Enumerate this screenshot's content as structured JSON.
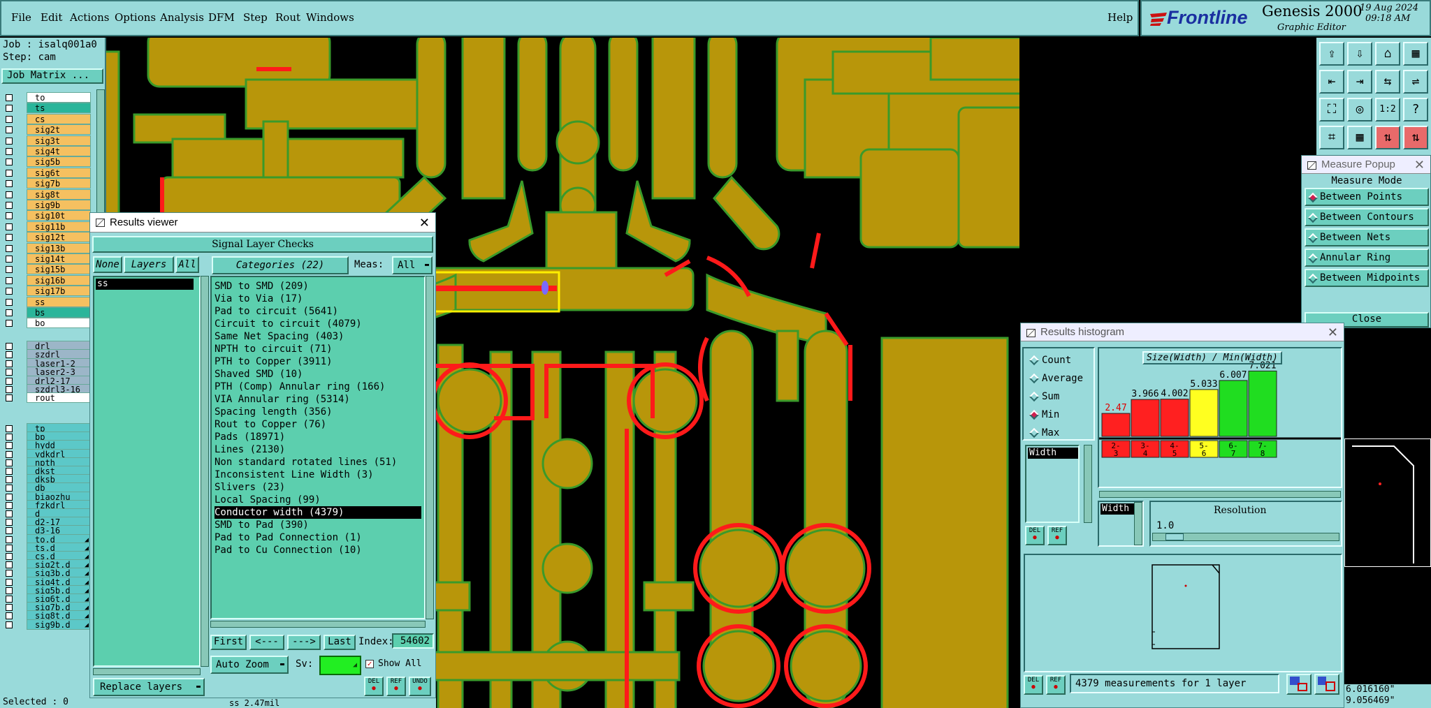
{
  "menu": [
    "File",
    "Edit",
    "Actions",
    "Options",
    "Analysis",
    "DFM",
    "Step",
    "Rout",
    "Windows"
  ],
  "help": "Help",
  "brand": {
    "logo": "Frontline",
    "product": "Genesis 2000",
    "subtitle": "Graphic Editor",
    "date": "19 Aug 2024",
    "time": "09:18 AM"
  },
  "job": {
    "job_label": "Job : isalq001a0",
    "step_label": "Step: cam",
    "matrix_button": "Job Matrix ..."
  },
  "layers_group1": [
    {
      "name": "to",
      "color": "#ffffff"
    },
    {
      "name": "ts",
      "color": "#2ab59a"
    },
    {
      "name": "cs",
      "color": "#f5c060"
    },
    {
      "name": "sig2t",
      "color": "#f5c060"
    },
    {
      "name": "sig3t",
      "color": "#f5c060"
    },
    {
      "name": "sig4t",
      "color": "#f5c060"
    },
    {
      "name": "sig5b",
      "color": "#f5c060"
    },
    {
      "name": "sig6t",
      "color": "#f5c060"
    },
    {
      "name": "sig7b",
      "color": "#f5c060"
    },
    {
      "name": "sig8t",
      "color": "#f5c060"
    },
    {
      "name": "sig9b",
      "color": "#f5c060"
    },
    {
      "name": "sig10t",
      "color": "#f5c060"
    },
    {
      "name": "sig11b",
      "color": "#f5c060"
    },
    {
      "name": "sig12t",
      "color": "#f5c060"
    },
    {
      "name": "sig13b",
      "color": "#f5c060"
    },
    {
      "name": "sig14t",
      "color": "#f5c060"
    },
    {
      "name": "sig15b",
      "color": "#f5c060"
    },
    {
      "name": "sig16b",
      "color": "#f5c060"
    },
    {
      "name": "sig17b",
      "color": "#f5c060"
    },
    {
      "name": "ss",
      "color": "#f5c060"
    },
    {
      "name": "bs",
      "color": "#2ab59a"
    },
    {
      "name": "bo",
      "color": "#ffffff"
    }
  ],
  "layers_group2": [
    {
      "name": "drl",
      "color": "#9cb6c8"
    },
    {
      "name": "szdrl",
      "color": "#9cb6c8"
    },
    {
      "name": "laser1-2",
      "color": "#9cb6c8"
    },
    {
      "name": "laser2-3",
      "color": "#9cb6c8"
    },
    {
      "name": "drl2-17",
      "color": "#9cb6c8"
    },
    {
      "name": "szdrl3-16",
      "color": "#9cb6c8"
    },
    {
      "name": "rout",
      "color": "#ffffff"
    }
  ],
  "layers_group3": [
    {
      "name": "tp",
      "a": ""
    },
    {
      "name": "bp",
      "a": ""
    },
    {
      "name": "hydd",
      "a": ""
    },
    {
      "name": "ydkdrl",
      "a": ""
    },
    {
      "name": "npth",
      "a": ""
    },
    {
      "name": "dkst",
      "a": ""
    },
    {
      "name": "dksb",
      "a": ""
    },
    {
      "name": "db",
      "a": ""
    },
    {
      "name": "biaozhu",
      "a": ""
    },
    {
      "name": "fzkdrl",
      "a": ""
    },
    {
      "name": "d",
      "a": ""
    },
    {
      "name": "d2-17",
      "a": ""
    },
    {
      "name": "d3-16",
      "a": ""
    },
    {
      "name": "to.d",
      "a": "◢"
    },
    {
      "name": "ts.d",
      "a": "◢"
    },
    {
      "name": "cs.d",
      "a": "◢"
    },
    {
      "name": "sig2t.d",
      "a": "◢"
    },
    {
      "name": "sig3b.d",
      "a": "◢"
    },
    {
      "name": "sig4t.d",
      "a": "◢"
    },
    {
      "name": "sig5b.d",
      "a": "◢"
    },
    {
      "name": "sig6t.d",
      "a": "◢"
    },
    {
      "name": "sig7b.d",
      "a": "◢"
    },
    {
      "name": "sig8t.d",
      "a": "◢"
    },
    {
      "name": "sig9b.d",
      "a": "◢"
    }
  ],
  "selected": "Selected : 0",
  "status_text": "ss 2.47mil",
  "coords": {
    "x": "6.016160\"",
    "y": "9.056469\""
  },
  "results_viewer": {
    "title": "Results viewer",
    "header": "Signal Layer Checks",
    "none": "None",
    "layers": "Layers",
    "all": "All",
    "layer_items": [
      "ss"
    ],
    "categories_label": "Categories (22)",
    "meas_label": "Meas:",
    "meas_value": "All",
    "categories": [
      "SMD to SMD (209)",
      "Via to Via (17)",
      "Pad to circuit (5641)",
      "Circuit to circuit (4079)",
      "Same Net Spacing (403)",
      "NPTH to circuit (71)",
      "PTH to Copper (3911)",
      "Shaved SMD (10)",
      "PTH (Comp) Annular ring (166)",
      "VIA Annular ring (5314)",
      "Spacing length (356)",
      "Rout to Copper (76)",
      "Pads (18971)",
      "Lines (2130)",
      "Non standard rotated lines (51)",
      "Inconsistent Line Width (3)",
      "Slivers (23)",
      "Local Spacing (99)",
      "Conductor width (4379)",
      "SMD to Pad (390)",
      "Pad to Pad Connection (1)",
      "Pad to Cu Connection (10)"
    ],
    "selected_category": "Conductor width (4379)",
    "first": "First",
    "prev": "<---",
    "next": "--->",
    "last": "Last",
    "index_label": "Index:",
    "index_value": "54602",
    "replace_layers": "Replace layers",
    "auto_zoom": "Auto Zoom",
    "sv_label": "Sv:",
    "show_all": "Show All",
    "del": "DEL",
    "ref": "REF",
    "undo": "UNDO"
  },
  "measure_popup": {
    "title": "Measure Popup",
    "mode_label": "Measure Mode",
    "modes": [
      "Between Points",
      "Between Contours",
      "Between Nets",
      "Annular Ring",
      "Between Midpoints"
    ],
    "selected_mode": "Between Points",
    "close": "Close"
  },
  "histogram": {
    "title": "Results histogram",
    "stats": [
      "Count",
      "Average",
      "Sum",
      "Min",
      "Max"
    ],
    "selected_stat": "Min",
    "field": "Width",
    "chart_title": "Size(Width) / Min(Width)",
    "resolution_label": "Resolution",
    "resolution_value": "1.0",
    "del": "DEL",
    "ref": "REF",
    "summary": "4379 measurements for 1 layer"
  },
  "chart_data": {
    "type": "bar",
    "title": "Size(Width) / Min(Width)",
    "categories": [
      "2-3",
      "3-4",
      "4-5",
      "5-6",
      "6-7",
      "7-8"
    ],
    "values": [
      2.47,
      3.966,
      4.002,
      5.033,
      6.007,
      7.021
    ],
    "value_labels": [
      "2.47",
      "3.966",
      "4.002",
      "5.033",
      "6.007",
      "7.021"
    ],
    "colors": [
      "#ff2020",
      "#ff2020",
      "#ff2020",
      "#ffff20",
      "#20dd20",
      "#20dd20"
    ],
    "label_colors": [
      "#dd0000",
      "#000000",
      "#000000",
      "#000000",
      "#000000",
      "#000000"
    ],
    "ylim": [
      0,
      7.5
    ]
  },
  "colors": {
    "copper": "#b8960a",
    "outline": "#3a9a2a",
    "violation": "#ff1a1a",
    "highlight": "#ffee00",
    "ui": "#99dada",
    "list": "#5ccfae"
  }
}
